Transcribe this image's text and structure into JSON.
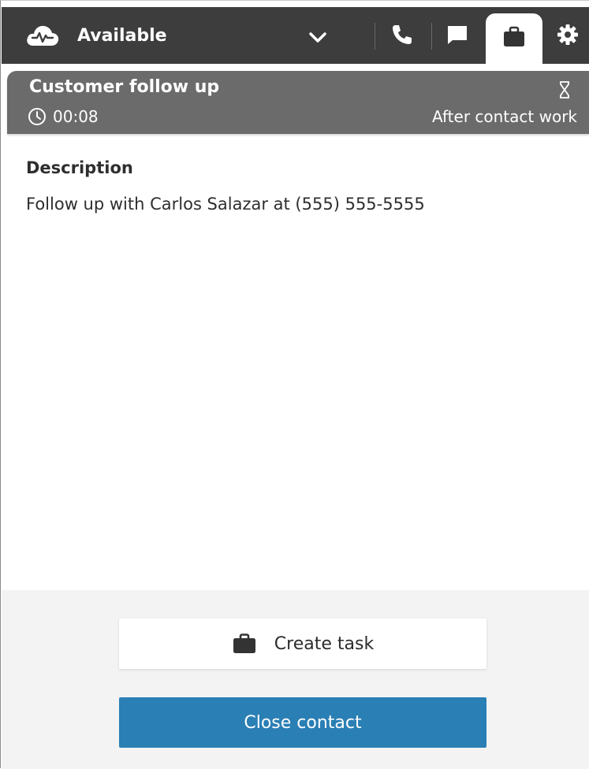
{
  "topbar": {
    "status_label": "Available",
    "icons": {
      "status": "cloud-agent-icon",
      "dropdown": "chevron-down-icon",
      "phone": "phone-icon",
      "chat": "chat-icon",
      "tasks": "briefcase-icon",
      "settings": "gear-icon"
    },
    "active_tab": "tasks"
  },
  "contact": {
    "title": "Customer follow up",
    "timer": "00:08",
    "state": "After contact work"
  },
  "body": {
    "description_heading": "Description",
    "description_text": "Follow up with Carlos Salazar at (555) 555-5555"
  },
  "footer": {
    "create_task_label": "Create task",
    "close_contact_label": "Close contact"
  },
  "colors": {
    "topbar_bg": "#3d3d3d",
    "contact_header_bg": "#6b6b6b",
    "primary_button": "#2a7fb5",
    "footer_bg": "#f3f3f3"
  }
}
